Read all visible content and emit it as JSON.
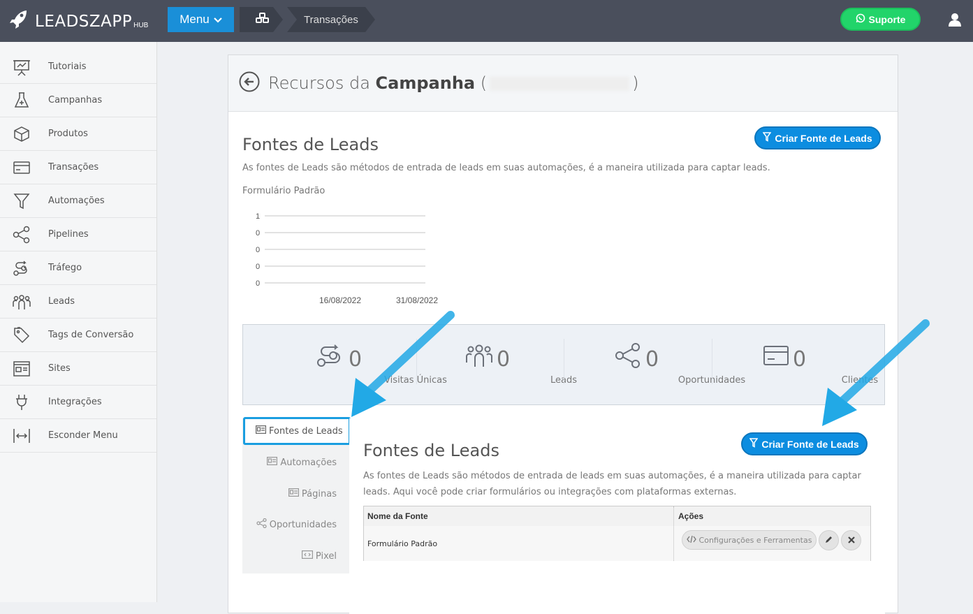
{
  "topbar": {
    "logo_text": "LEADSZAPP",
    "logo_sub": "HUB",
    "menu_label": "Menu",
    "breadcrumb_current": "Transações",
    "support_label": "Suporte"
  },
  "sidebar": {
    "items": [
      {
        "label": "Tutoriais",
        "icon": "presentation-icon"
      },
      {
        "label": "Campanhas",
        "icon": "flask-icon"
      },
      {
        "label": "Produtos",
        "icon": "box-icon"
      },
      {
        "label": "Transações",
        "icon": "credit-card-icon"
      },
      {
        "label": "Automações",
        "icon": "funnel-icon"
      },
      {
        "label": "Pipelines",
        "icon": "share-icon"
      },
      {
        "label": "Tráfego",
        "icon": "route-icon"
      },
      {
        "label": "Leads",
        "icon": "users-icon"
      },
      {
        "label": "Tags de Conversão",
        "icon": "tags-icon"
      },
      {
        "label": "Sites",
        "icon": "browser-icon"
      },
      {
        "label": "Integrações",
        "icon": "plug-icon"
      },
      {
        "label": "Esconder Menu",
        "icon": "arrows-horizontal-icon"
      }
    ]
  },
  "panel": {
    "title_prefix": "Recursos da",
    "title_bold": "Campanha",
    "title_open": "(",
    "title_close": ")"
  },
  "section": {
    "title": "Fontes de Leads",
    "description": "As fontes de Leads são métodos de entrada de leads em suas automações, é a maneira utilizada para captar leads.",
    "subtitle": "Formulário Padrão",
    "create_button": "Criar Fonte de Leads"
  },
  "chart_data": {
    "type": "line",
    "title": "Formulário Padrão",
    "x": [
      "16/08/2022",
      "31/08/2022"
    ],
    "y_ticks": [
      "1",
      "0",
      "0",
      "0",
      "0"
    ],
    "series": [
      {
        "values": [
          0,
          0
        ]
      }
    ],
    "ylim": [
      0,
      1
    ],
    "grid": true
  },
  "stats": [
    {
      "value": "0",
      "label": "Visitas Únicas",
      "icon": "route-icon"
    },
    {
      "value": "0",
      "label": "Leads",
      "icon": "users-icon"
    },
    {
      "value": "0",
      "label": "Oportunidades",
      "icon": "share-icon"
    },
    {
      "value": "0",
      "label": "Clientes",
      "icon": "credit-card-icon"
    }
  ],
  "tabs": [
    {
      "label": "Fontes de Leads",
      "icon": "form-icon",
      "active": true
    },
    {
      "label": "Automações",
      "icon": "form-icon"
    },
    {
      "label": "Páginas",
      "icon": "form-icon"
    },
    {
      "label": "Oportunidades",
      "icon": "share-icon"
    },
    {
      "label": "Pixel",
      "icon": "code-icon"
    }
  ],
  "content": {
    "title": "Fontes de Leads",
    "description": "As fontes de Leads são métodos de entrada de leads em suas automações, é a maneira utilizada para captar leads. Aqui você pode criar formulários ou integrações com plataformas externas.",
    "create_button": "Criar Fonte de Leads",
    "table": {
      "headers": [
        "Nome da Fonte",
        "Ações"
      ],
      "rows": [
        {
          "name": "Formulário Padrão",
          "action_label": "Configurações e Ferramentas"
        }
      ]
    }
  },
  "colors": {
    "topbar": "#4a4f5c",
    "accent": "#0c8de0",
    "support": "#22d46a",
    "highlight": "#1a9ee0"
  }
}
